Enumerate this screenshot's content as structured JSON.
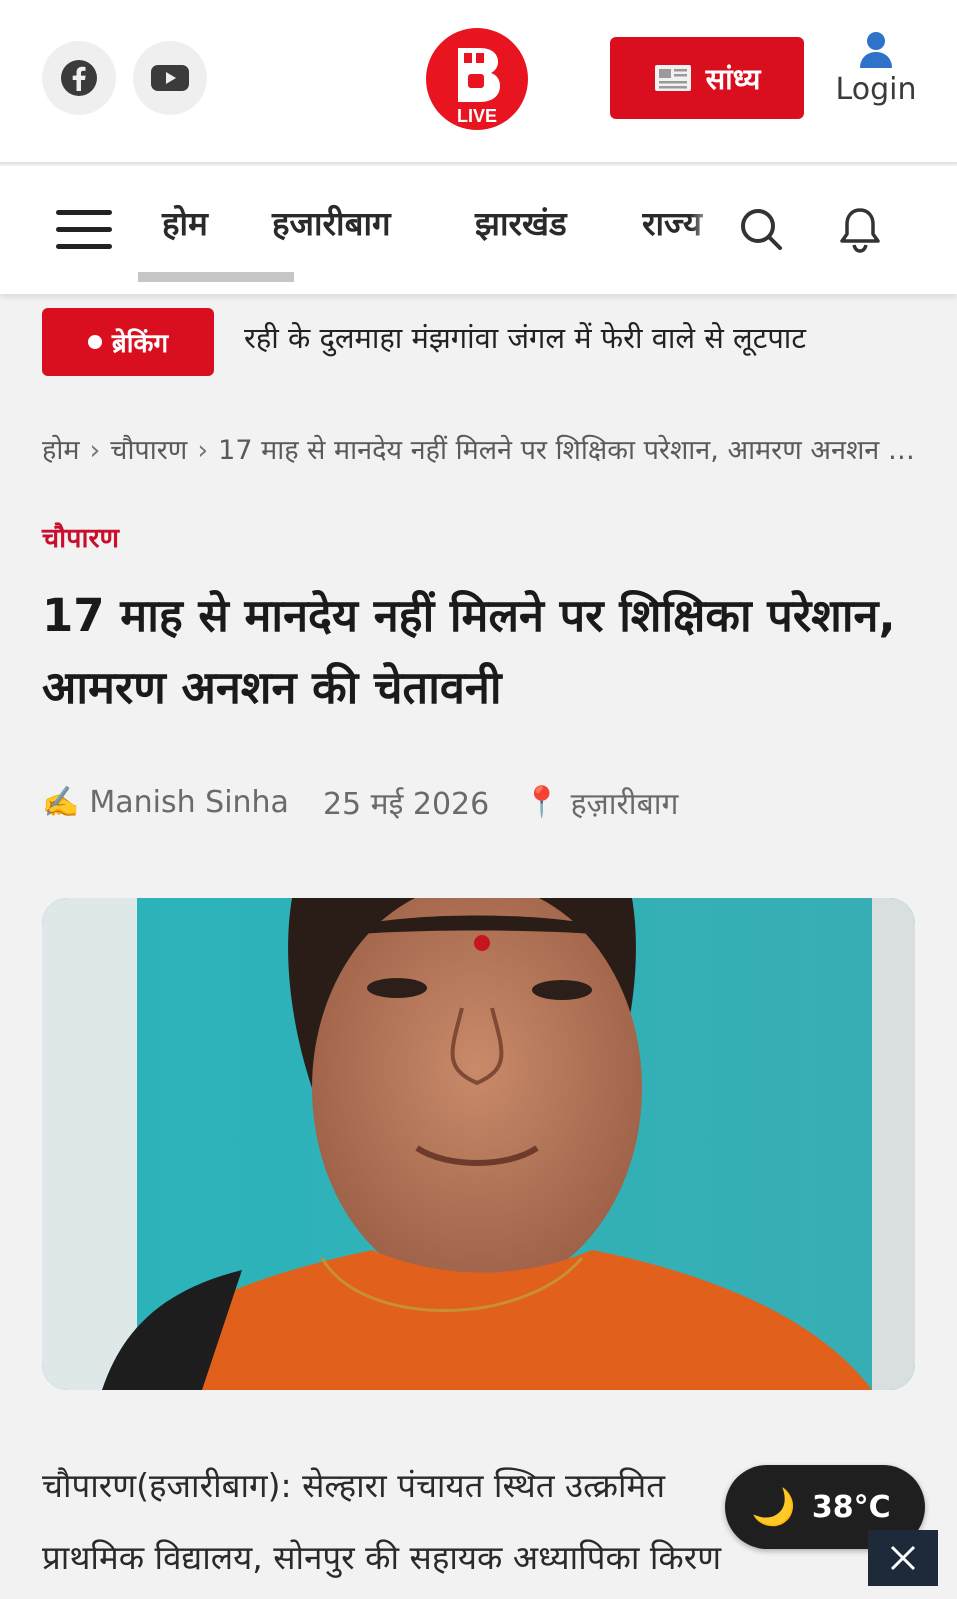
{
  "header": {
    "logo_text": "LIVE",
    "sandhya_label": "सांध्य",
    "login_label": "Login",
    "social": [
      "facebook-icon",
      "youtube-icon"
    ],
    "brand_color": "#d90f1f"
  },
  "nav": {
    "items": [
      {
        "label": "होम",
        "active": true
      },
      {
        "label": "हजारीबाग"
      },
      {
        "label": "झारखंड"
      },
      {
        "label": "राज्य"
      }
    ]
  },
  "breaking": {
    "badge_label": "ब्रेकिंग",
    "ticker_text": "रही के दुलमाहा मंझगांवा जंगल में फेरी वाले से लूटपाट"
  },
  "breadcrumb": {
    "home": "होम",
    "category": "चौपारण",
    "current": "17 माह से मानदेय नहीं मिलने पर शिक्षिका परेशान, आमरण अनशन की चेतावनी"
  },
  "article": {
    "category": "चौपारण",
    "title": "17 माह से मानदेय नहीं मिलने पर शिक्षिका परेशान, आमरण अनशन की चेतावनी",
    "author_icon": "✍️",
    "author": "Manish Sinha",
    "date": "25 मई 2026",
    "location_icon": "📍",
    "location": "हज़ारीबाग",
    "body_line1": "चौपारण(हजारीबाग): सेल्हारा पंचायत स्थित उत्क्रमित",
    "body_line2": "प्राथमिक विद्यालय, सोनपुर की सहायक अध्यापिका किरण"
  },
  "weather": {
    "icon": "🌙",
    "temperature": "38°C"
  }
}
